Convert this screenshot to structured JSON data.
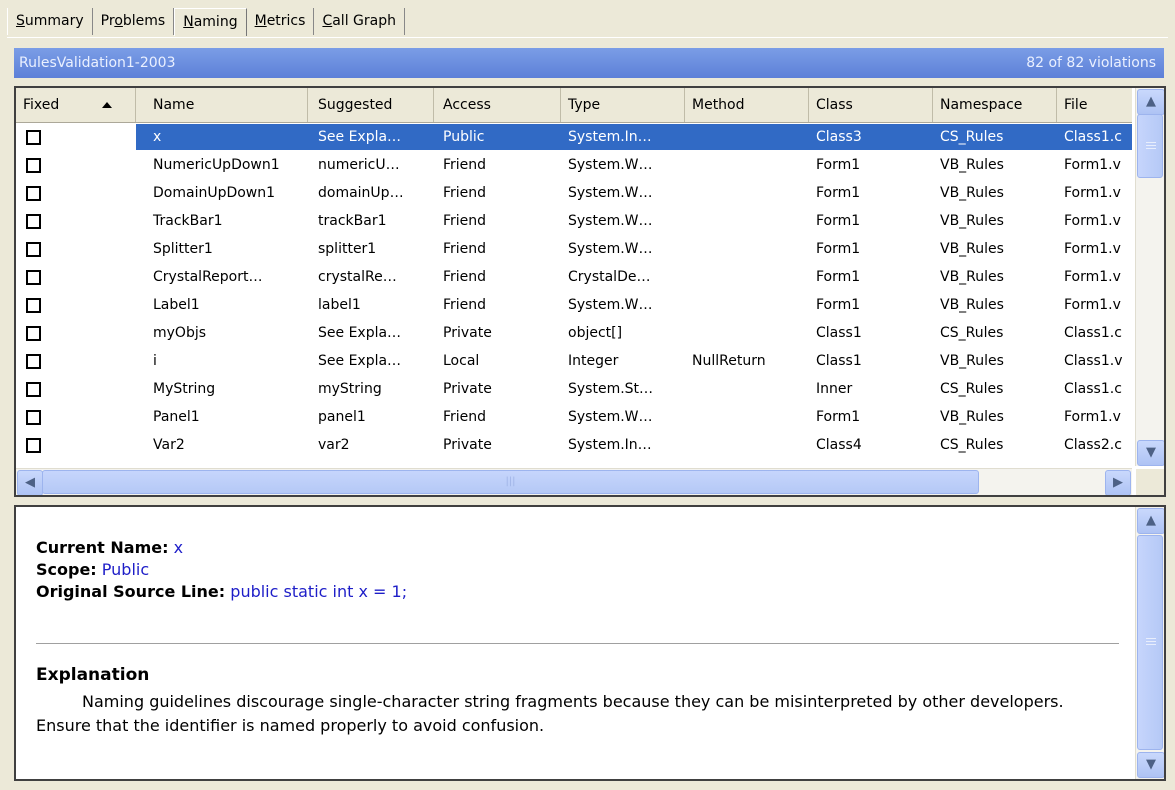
{
  "tabs": [
    {
      "label": "Summary",
      "underline_index": 0,
      "active": false
    },
    {
      "label": "Problems",
      "underline_index": 2,
      "active": false
    },
    {
      "label": "Naming",
      "underline_index": 0,
      "active": true
    },
    {
      "label": "Metrics",
      "underline_index": 0,
      "active": false
    },
    {
      "label": "Call Graph",
      "underline_index": 0,
      "active": false
    }
  ],
  "header": {
    "title": "RulesValidation1-2003",
    "count": "82 of 82 violations"
  },
  "grid": {
    "columns": [
      {
        "key": "fixed",
        "label": "Fixed",
        "sorted": "ascending"
      },
      {
        "key": "name",
        "label": "Name"
      },
      {
        "key": "suggested",
        "label": "Suggested"
      },
      {
        "key": "access",
        "label": "Access"
      },
      {
        "key": "type",
        "label": "Type"
      },
      {
        "key": "method",
        "label": "Method"
      },
      {
        "key": "class",
        "label": "Class"
      },
      {
        "key": "namespace",
        "label": "Namespace"
      },
      {
        "key": "file",
        "label": "File"
      }
    ],
    "rows": [
      {
        "fixed": false,
        "selected": true,
        "name": "x",
        "suggested": "See Expla…",
        "access": "Public",
        "type": "System.In…",
        "method": "",
        "class": "Class3",
        "namespace": "CS_Rules",
        "file": "Class1.c"
      },
      {
        "fixed": false,
        "selected": false,
        "name": "NumericUpDown1",
        "suggested": "numericU…",
        "access": "Friend",
        "type": "System.W…",
        "method": "",
        "class": "Form1",
        "namespace": "VB_Rules",
        "file": "Form1.v"
      },
      {
        "fixed": false,
        "selected": false,
        "name": "DomainUpDown1",
        "suggested": "domainUp…",
        "access": "Friend",
        "type": "System.W…",
        "method": "",
        "class": "Form1",
        "namespace": "VB_Rules",
        "file": "Form1.v"
      },
      {
        "fixed": false,
        "selected": false,
        "name": "TrackBar1",
        "suggested": "trackBar1",
        "access": "Friend",
        "type": "System.W…",
        "method": "",
        "class": "Form1",
        "namespace": "VB_Rules",
        "file": "Form1.v"
      },
      {
        "fixed": false,
        "selected": false,
        "name": "Splitter1",
        "suggested": "splitter1",
        "access": "Friend",
        "type": "System.W…",
        "method": "",
        "class": "Form1",
        "namespace": "VB_Rules",
        "file": "Form1.v"
      },
      {
        "fixed": false,
        "selected": false,
        "name": "CrystalReport…",
        "suggested": "crystalRe…",
        "access": "Friend",
        "type": "CrystalDe…",
        "method": "",
        "class": "Form1",
        "namespace": "VB_Rules",
        "file": "Form1.v"
      },
      {
        "fixed": false,
        "selected": false,
        "name": "Label1",
        "suggested": "label1",
        "access": "Friend",
        "type": "System.W…",
        "method": "",
        "class": "Form1",
        "namespace": "VB_Rules",
        "file": "Form1.v"
      },
      {
        "fixed": false,
        "selected": false,
        "name": "myObjs",
        "suggested": "See Expla…",
        "access": "Private",
        "type": "object[]",
        "method": "",
        "class": "Class1",
        "namespace": "CS_Rules",
        "file": "Class1.c"
      },
      {
        "fixed": false,
        "selected": false,
        "name": "i",
        "suggested": "See Expla…",
        "access": "Local",
        "type": "Integer",
        "method": "NullReturn",
        "class": "Class1",
        "namespace": "VB_Rules",
        "file": "Class1.v"
      },
      {
        "fixed": false,
        "selected": false,
        "name": "MyString",
        "suggested": "myString",
        "access": "Private",
        "type": "System.St…",
        "method": "",
        "class": "Inner",
        "namespace": "CS_Rules",
        "file": "Class1.c"
      },
      {
        "fixed": false,
        "selected": false,
        "name": "Panel1",
        "suggested": "panel1",
        "access": "Friend",
        "type": "System.W…",
        "method": "",
        "class": "Form1",
        "namespace": "VB_Rules",
        "file": "Form1.v"
      },
      {
        "fixed": false,
        "selected": false,
        "name": "Var2",
        "suggested": "var2",
        "access": "Private",
        "type": "System.In…",
        "method": "",
        "class": "Class4",
        "namespace": "CS_Rules",
        "file": "Class2.c"
      }
    ]
  },
  "detail": {
    "current_name_label": "Current Name:",
    "current_name_value": "x",
    "scope_label": "Scope:",
    "scope_value": "Public",
    "source_label": "Original Source Line:",
    "source_value": "public static int x = 1;",
    "explanation_heading": "Explanation",
    "explanation_text": "Naming guidelines discourage single-character string fragments because they can be misinterpreted by other developers. Ensure that the identifier is named properly to avoid confusion."
  },
  "icons": {
    "scroll_up": "scroll-up-arrow-icon",
    "scroll_down": "scroll-down-arrow-icon",
    "scroll_left": "scroll-left-arrow-icon",
    "scroll_right": "scroll-right-arrow-icon",
    "sort": "sort-ascending-icon"
  },
  "colors": {
    "selection": "#316ac5",
    "header_bar": "#5d80d8",
    "detail_value": "#1e1ec8"
  }
}
